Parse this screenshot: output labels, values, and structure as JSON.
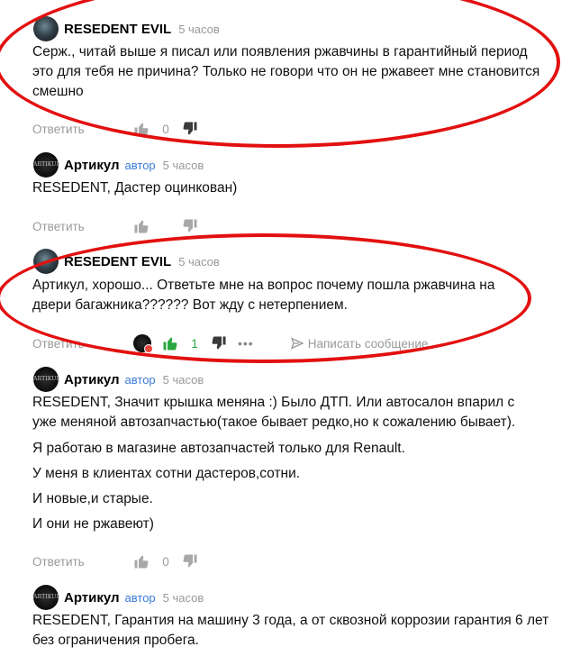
{
  "comments": [
    {
      "author": "RESEDENT EVIL",
      "badge": "",
      "time": "5 часов",
      "lines": [
        "Серж., читай выше я писал или появления ржавчины в гарантийный период это для тебя не причина? Только не говори что он не ржавеет мне становится смешно"
      ],
      "reply": "Ответить",
      "likes": "0"
    },
    {
      "author": "Артикул",
      "badge": "автор",
      "time": "5 часов",
      "lines": [
        "RESEDENT, Дастер оцинкован)"
      ],
      "reply": "Ответить",
      "likes": ""
    },
    {
      "author": "RESEDENT EVIL",
      "badge": "",
      "time": "5 часов",
      "lines": [
        "Артикул, хорошо... Ответьте мне на вопрос почему пошла ржавчина на двери багажника?????? Вот жду с нетерпением."
      ],
      "reply": "Ответить",
      "likes": "1",
      "write_reply": "Написать сообщение"
    },
    {
      "author": "Артикул",
      "badge": "автор",
      "time": "5 часов",
      "lines": [
        "RESEDENT, Значит крышка меняна :) Было ДТП. Или автосалон впарил с уже меняной автозапчастью(такое бывает редко,но к сожалению бывает).",
        "Я работаю в магазине автозапчастей только для Renault.",
        "У меня в клиентах сотни дастеров,сотни.",
        "И новые,и старые.",
        "И они не ржавеют)"
      ],
      "reply": "Ответить",
      "likes": "0"
    },
    {
      "author": "Артикул",
      "badge": "автор",
      "time": "5 часов",
      "lines": [
        "RESEDENT, Гарантия на машину 3 года, а от сквозной коррозии гарантия 6 лет без ограничения пробега."
      ]
    }
  ],
  "avatar_text": "ARTIKUL",
  "colors": {
    "accent": "#3a7bd5",
    "like_active": "#2aa840",
    "highlight": "#e31010"
  },
  "icons": [
    "thumbs-up-icon",
    "thumbs-down-icon",
    "more-dots-icon",
    "send-icon"
  ]
}
